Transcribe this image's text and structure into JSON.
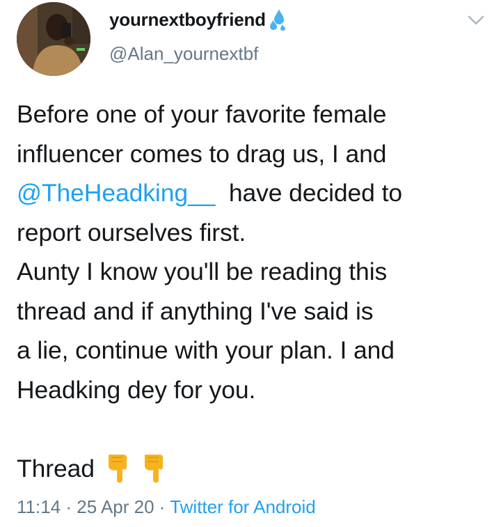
{
  "author": {
    "display_name": "yournextboyfriend",
    "handle": "@Alan_yournextbf",
    "name_emoji_icon": "sweat-droplets-icon",
    "avatar_icon": "profile-photo"
  },
  "menu": {
    "icon": "chevron-down-icon"
  },
  "tweet": {
    "line1": "Before one of your favorite female",
    "line2": "influencer comes to drag us, I and",
    "mention": "@TheHeadking__",
    "line3_rest": "  have decided to",
    "line4": "report ourselves first.",
    "line5": "Aunty I know you'll be reading this",
    "line6": "thread and if anything I've said is",
    "line7": "a lie, continue with your plan. I and",
    "line8": "Headking dey for you.",
    "thread_label": "Thread",
    "thread_emoji_icon": "backhand-index-pointing-down-icon"
  },
  "meta": {
    "time": "11:14",
    "separator": " · ",
    "date": "25 Apr 20",
    "source": "Twitter for Android"
  },
  "colors": {
    "link": "#1da1f2",
    "secondary_text": "#657786",
    "primary_text": "#14171a",
    "emoji_yellow": "#f6b31e"
  }
}
